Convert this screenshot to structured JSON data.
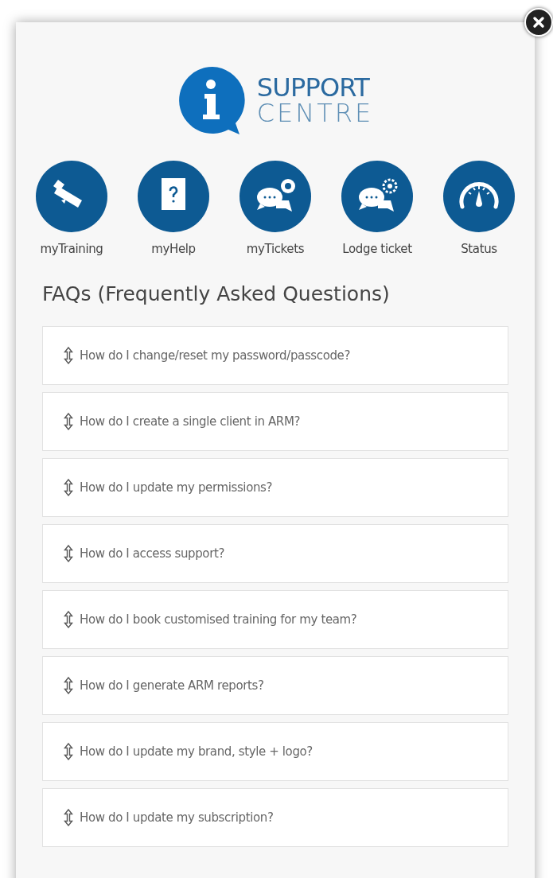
{
  "logo": {
    "line_1": "SUPPORT",
    "line_2": "CENTRE"
  },
  "shortcuts": [
    {
      "kind": "training",
      "label": "myTraining"
    },
    {
      "kind": "help",
      "label": "myHelp"
    },
    {
      "kind": "tickets",
      "label": "myTickets"
    },
    {
      "kind": "lodge",
      "label": "Lodge ticket"
    },
    {
      "kind": "status",
      "label": "Status"
    }
  ],
  "faq_title": "FAQs (Frequently Asked Questions)",
  "faqs": [
    "How do I change/reset my password/passcode?",
    "How do I create a single client in ARM?",
    "How do I update my permissions?",
    "How do I access support?",
    "How do I book customised training for my team?",
    "How do I generate ARM reports?",
    "How do I update my brand, style + logo?",
    "How do I update my subscription?"
  ]
}
